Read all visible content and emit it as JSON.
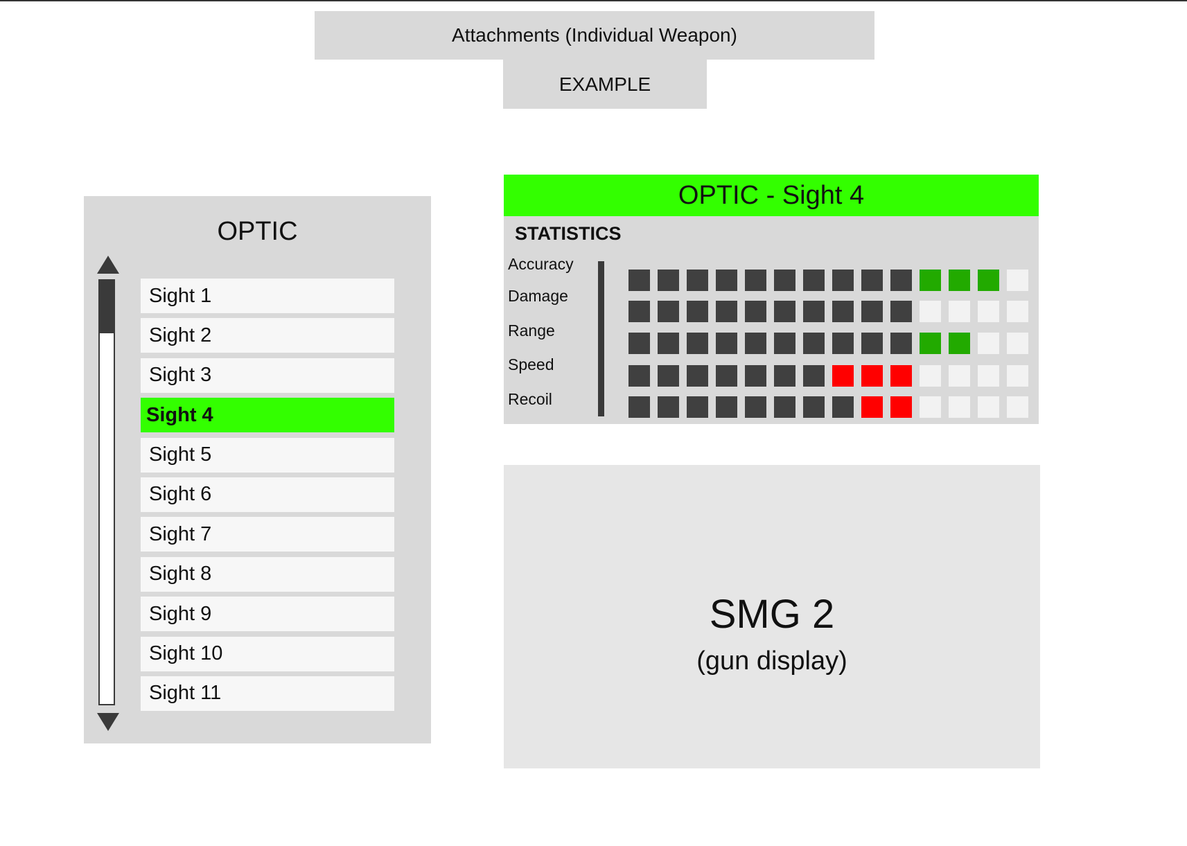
{
  "header": {
    "title": "Attachments (Individual Weapon)",
    "example_tab": "EXAMPLE"
  },
  "optic_panel": {
    "title": "OPTIC",
    "items": [
      {
        "label": "Sight 1",
        "selected": false
      },
      {
        "label": "Sight 2",
        "selected": false
      },
      {
        "label": "Sight 3",
        "selected": false
      },
      {
        "label": "Sight 4",
        "selected": true
      },
      {
        "label": "Sight 5",
        "selected": false
      },
      {
        "label": "Sight 6",
        "selected": false
      },
      {
        "label": "Sight 7",
        "selected": false
      },
      {
        "label": "Sight 8",
        "selected": false
      },
      {
        "label": "Sight 9",
        "selected": false
      },
      {
        "label": "Sight 10",
        "selected": false
      },
      {
        "label": "Sight 11",
        "selected": false
      }
    ]
  },
  "stats_panel": {
    "header": "OPTIC - Sight 4",
    "section_label": "STATISTICS",
    "total_segments": 14,
    "colors": {
      "base": "#404040",
      "bonus": "#22aa00",
      "penalty": "#ff0000",
      "empty": "#f2f2f2"
    },
    "stats": [
      {
        "name": "Accuracy",
        "base": 10,
        "bonus": 3,
        "penalty": 0
      },
      {
        "name": "Damage",
        "base": 10,
        "bonus": 0,
        "penalty": 0
      },
      {
        "name": "Range",
        "base": 10,
        "bonus": 2,
        "penalty": 0
      },
      {
        "name": "Speed",
        "base": 7,
        "bonus": 0,
        "penalty": 3
      },
      {
        "name": "Recoil",
        "base": 8,
        "bonus": 0,
        "penalty": 2
      }
    ]
  },
  "gun_display": {
    "name": "SMG 2",
    "caption": "(gun display)"
  }
}
